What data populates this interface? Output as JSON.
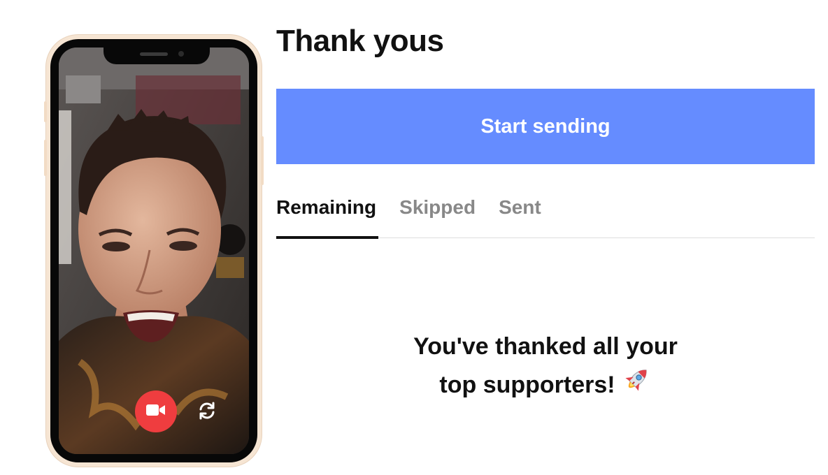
{
  "page": {
    "title": "Thank yous"
  },
  "actions": {
    "start_label": "Start sending"
  },
  "tabs": [
    {
      "label": "Remaining",
      "active": true
    },
    {
      "label": "Skipped",
      "active": false
    },
    {
      "label": "Sent",
      "active": false
    }
  ],
  "empty_state": {
    "line1": "You've thanked all your",
    "line2": "top supporters!",
    "icon": "rocket-icon"
  },
  "phone": {
    "record_icon": "video-camera-icon",
    "flip_icon": "flip-camera-icon"
  },
  "colors": {
    "accent": "#658cff",
    "record": "#ef3d3f",
    "text": "#111111",
    "muted_tab": "#888888"
  }
}
